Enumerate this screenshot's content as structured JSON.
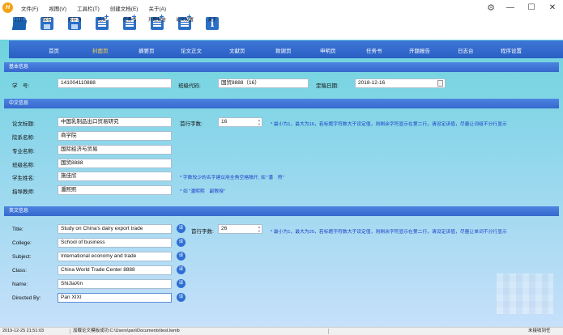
{
  "app": {
    "logo": "H"
  },
  "menu": [
    "文件(F)",
    "视图(V)",
    "工具栏(T)",
    "创建文档(E)",
    "关于(A)"
  ],
  "window": {
    "settings_icon": "gear-icon",
    "minimize": "—",
    "maximize": "☐",
    "close": "✕"
  },
  "toolbar": [
    {
      "label": "打开",
      "icon": "folder-open-icon"
    },
    {
      "label": "保存",
      "icon": "save-icon"
    },
    {
      "label": "另存为",
      "icon": "save-as-icon"
    },
    {
      "label": "论文",
      "icon": "paper-add-icon"
    },
    {
      "label": "任务书",
      "icon": "task-book-icon"
    },
    {
      "label": "开题报告",
      "icon": "proposal-icon"
    },
    {
      "label": "论文设置",
      "icon": "paper-settings-icon"
    },
    {
      "label": "关于",
      "icon": "info-icon"
    }
  ],
  "nav": {
    "items": [
      "首页",
      "封面页",
      "摘要页",
      "论文正文",
      "文献页",
      "致谢页",
      "申明页",
      "任务书",
      "开题报告",
      "日志台",
      "程序设置"
    ],
    "active": "封面页",
    "active_color": "#ffd54a"
  },
  "basic": {
    "title": "基本信息",
    "student_id_label": "学　号:",
    "student_id": "141004110888",
    "class_code_label": "班级代码:",
    "class_code": "国贸8888（16）",
    "defense_date_label": "定稿日期:",
    "defense_date": "2018-12-16"
  },
  "chinese": {
    "title": "中文信息",
    "thesis_title_label": "论文标题:",
    "thesis_title": "中国乳制品出口贸易研究",
    "line_chars_label": "首行字数:",
    "line_chars": "16",
    "line_chars_note": "* 最小为1，最大为16，若标题字符数大于设定值，则剩余字符显示在第二行，请设定该值，尽量让词组不分行显示",
    "dept_label": "院系名称:",
    "dept": "商学院",
    "major_label": "专业名称:",
    "major": "国际经济与贸易",
    "class_label": "班级名称:",
    "class_name": "国贸8888",
    "student_label": "学生姓名:",
    "student": "施佳欣",
    "student_note": "* 字数较少的名字建议用全角空格隔开, 如 \"潘　煦\"",
    "advisor_label": "指导教师:",
    "advisor": "潘熙熙",
    "advisor_note": "* 如 \"潘熙熙　副教授\""
  },
  "english": {
    "title": "英文信息",
    "title_label": "Title:",
    "title_value": "Study on China's dairy export trade",
    "line_chars_label": "首行字数:",
    "line_chars": "26",
    "line_chars_note": "* 最小为1，最大为25，若标题字符数大于设定值，则剩余字符显示在第二行，请设定该值，尽量让单词不分行显示",
    "college_label": "College:",
    "college": "School of business",
    "subject_label": "Subject:",
    "subject": "International economy and trade",
    "class_label": "Class:",
    "class_name": "China World Trade Center 8888",
    "name_label": "Name:",
    "name": "ShiJiaXin",
    "directed_label": "Directed By:",
    "directed": "Pan XIXI",
    "translate_label": "译"
  },
  "status": {
    "time": "2019-12-25 21:51:03",
    "message": "加载论文模板成功:C:\\Users\\pan\\Documents\\test.lwmb",
    "right": "未接收到任"
  }
}
